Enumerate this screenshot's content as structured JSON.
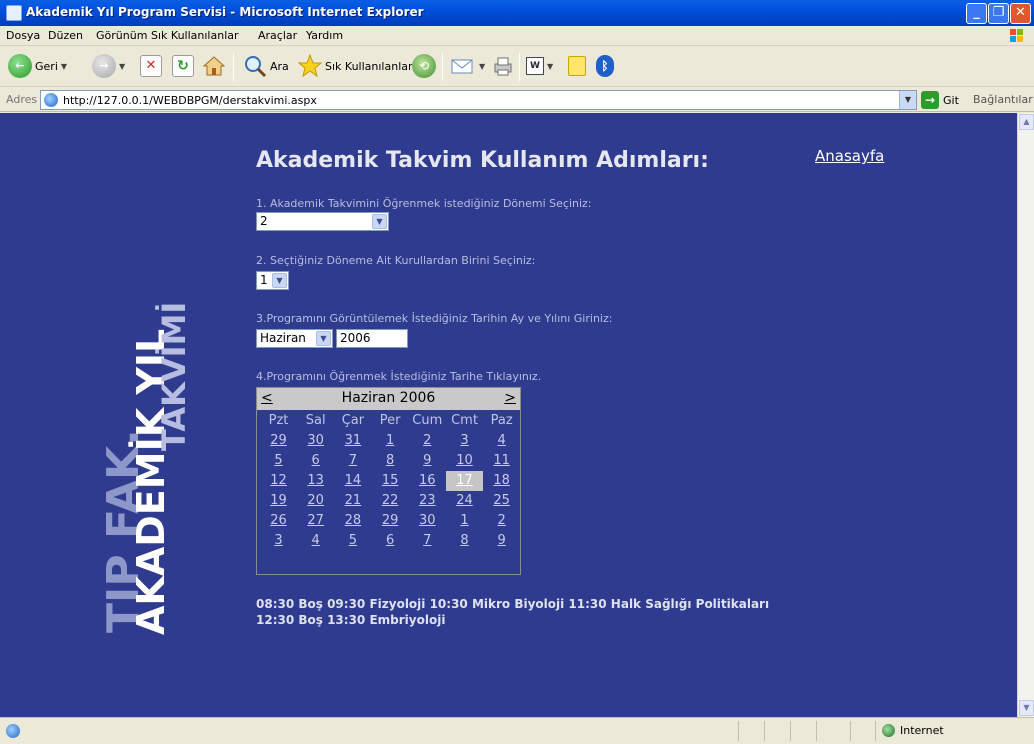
{
  "window": {
    "title": "Akademik Yıl Program Servisi - Microsoft Internet Explorer",
    "minimize": "_",
    "maximize": "❐",
    "close": "✕"
  },
  "menu": [
    "Dosya",
    "Düzen",
    "Görünüm",
    "Sık Kullanılanlar",
    "Araçlar",
    "Yardım"
  ],
  "toolbar": {
    "back": "Geri",
    "search": "Ara",
    "favorites": "Sık Kullanılanlar"
  },
  "address": {
    "label": "Adres",
    "url": "http://127.0.0.1/WEBDBPGM/derstakvimi.aspx",
    "go": "Git",
    "links": "Bağlantılar"
  },
  "side_title": {
    "line1": "TIP FAK.",
    "line2": "AKADEMİK YIL",
    "line3": "TAKVİMİ"
  },
  "page": {
    "heading": "Akademik Takvim Kullanım Adımları:",
    "home_link": "Anasayfa",
    "step1": "1. Akademik Takvimini Öğrenmek istediğiniz Dönemi Seçiniz:",
    "step1_value": "2",
    "step2": "2. Seçtiğiniz Döneme Ait Kurullardan Birini Seçiniz:",
    "step2_value": "1",
    "step3": "3.Programını Görüntülemek İstediğiniz Tarihin Ay ve Yılını Giriniz:",
    "month_value": "Haziran",
    "year_value": "2006",
    "step4": "4.Programını Öğrenmek İstediğiniz Tarihe Tıklayınız."
  },
  "calendar": {
    "prev": "<",
    "next": ">",
    "title": "Haziran 2006",
    "days_of_week": [
      "Pzt",
      "Sal",
      "Çar",
      "Per",
      "Cum",
      "Cmt",
      "Paz"
    ],
    "weeks": [
      [
        "29",
        "30",
        "31",
        "1",
        "2",
        "3",
        "4"
      ],
      [
        "5",
        "6",
        "7",
        "8",
        "9",
        "10",
        "11"
      ],
      [
        "12",
        "13",
        "14",
        "15",
        "16",
        "17",
        "18"
      ],
      [
        "19",
        "20",
        "21",
        "22",
        "23",
        "24",
        "25"
      ],
      [
        "26",
        "27",
        "28",
        "29",
        "30",
        "1",
        "2"
      ],
      [
        "3",
        "4",
        "5",
        "6",
        "7",
        "8",
        "9"
      ]
    ],
    "selected": "17"
  },
  "schedule": {
    "line1": "08:30 Boş 09:30 Fizyoloji 10:30 Mikro Biyoloji 11:30 Halk Sağlığı Politikaları",
    "line2": "12:30 Boş 13:30 Embriyoloji"
  },
  "status": {
    "zone": "Internet"
  }
}
